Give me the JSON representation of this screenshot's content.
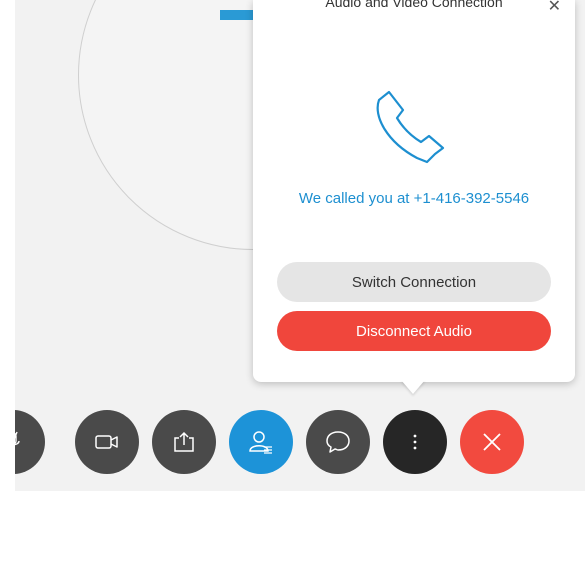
{
  "dialog": {
    "title": "Audio and Video Connection",
    "close_icon": "close-icon",
    "status_text": "We called you at +1-416-392-5546",
    "switch_label": "Switch Connection",
    "disconnect_label": "Disconnect Audio"
  },
  "controls": [
    {
      "name": "mute",
      "icon": "microphone-muted-icon"
    },
    {
      "name": "video",
      "icon": "video-camera-icon"
    },
    {
      "name": "share",
      "icon": "share-upload-icon"
    },
    {
      "name": "participants",
      "icon": "participants-icon"
    },
    {
      "name": "chat",
      "icon": "chat-bubble-icon"
    },
    {
      "name": "more",
      "icon": "more-vertical-icon"
    },
    {
      "name": "leave",
      "icon": "close-icon"
    }
  ],
  "colors": {
    "accent_blue": "#1d93d8",
    "danger_red": "#f24a3f",
    "dark_button": "#4a4a4a"
  }
}
